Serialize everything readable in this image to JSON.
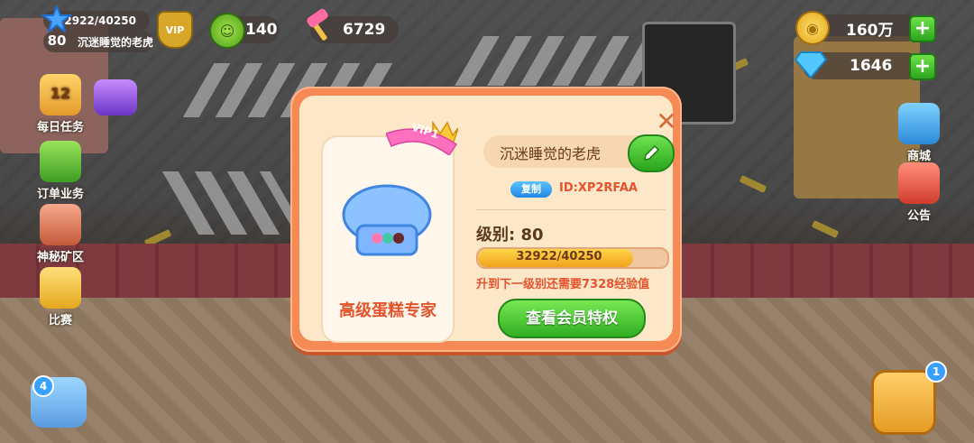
{
  "player": {
    "level": "80",
    "xp_text": "32922/40250",
    "xp_fraction": 0.818,
    "name": "沉迷睡觉的老虎",
    "vip_badge": "VIP"
  },
  "currencies": {
    "smile_count": "140",
    "hammer_count": "6729",
    "coins": "160万",
    "gems": "1646"
  },
  "left_menu": [
    {
      "label": "每日任务",
      "icon": "calendar-icon"
    },
    {
      "label": "订单业务",
      "icon": "clipboard-icon"
    },
    {
      "label": "神秘矿区",
      "icon": "mine-icon"
    },
    {
      "label": "比赛",
      "icon": "trophy-icon"
    }
  ],
  "right_menu": [
    {
      "label": "商城",
      "icon": "cart-icon"
    },
    {
      "label": "公告",
      "icon": "notice-icon"
    }
  ],
  "badges": {
    "left_bottom": "4",
    "right_bottom": "1",
    "calendar_date": "12"
  },
  "dialog": {
    "vip_ribbon": "VIP1",
    "card_title": "高级蛋糕专家",
    "player_name": "沉迷睡觉的老虎",
    "copy_label": "复制",
    "id_text": "ID:XP2RFAA",
    "level_label": "级别: 80",
    "xp_text": "32922/40250",
    "need_text": "升到下一级别还需要7328经验值",
    "vip_button": "查看会员特权"
  },
  "colors": {
    "dialog_border": "#f58a55",
    "dialog_bg": "#fde7c9",
    "accent_red": "#e4532c",
    "button_green": "#2fae22"
  }
}
